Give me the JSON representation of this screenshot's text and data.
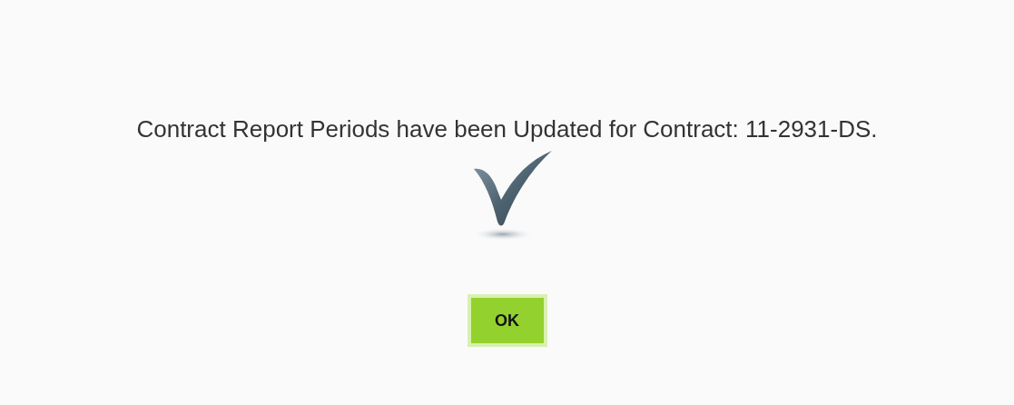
{
  "dialog": {
    "message": "Contract Report Periods have been Updated for Contract: 11-2931-DS.",
    "buttons": [
      "OK"
    ]
  }
}
